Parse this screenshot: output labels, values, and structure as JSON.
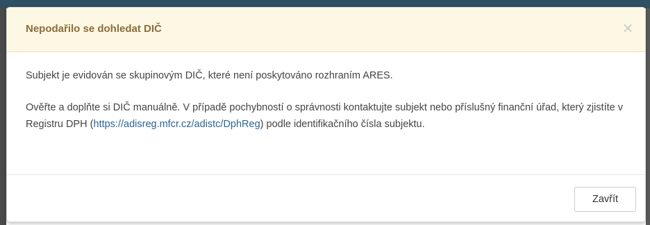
{
  "modal": {
    "title": "Nepodařilo se dohledat DIČ",
    "close_icon_glyph": "×",
    "close_icon_name": "close-icon",
    "paragraph1": "Subjekt je evidován se skupinovým DIČ, které není poskytováno rozhraním ARES.",
    "paragraph2_before_link": "Ověřte a doplňte si DIČ manuálně. V případě pochybností o správnosti kontaktujte subjekt nebo příslušný finanční úřad, který zjistíte v Registru DPH (",
    "paragraph2_link": "https://adisreg.mfcr.cz/adistc/DphReg",
    "paragraph2_after_link": ") podle identifikačního čísla subjektu.",
    "footer_close_label": "Zavřít"
  },
  "colors": {
    "header_bg": "#fcf8e3",
    "title_color": "#8a6d3b",
    "link_color": "#2a6496",
    "text_color": "#444444"
  }
}
